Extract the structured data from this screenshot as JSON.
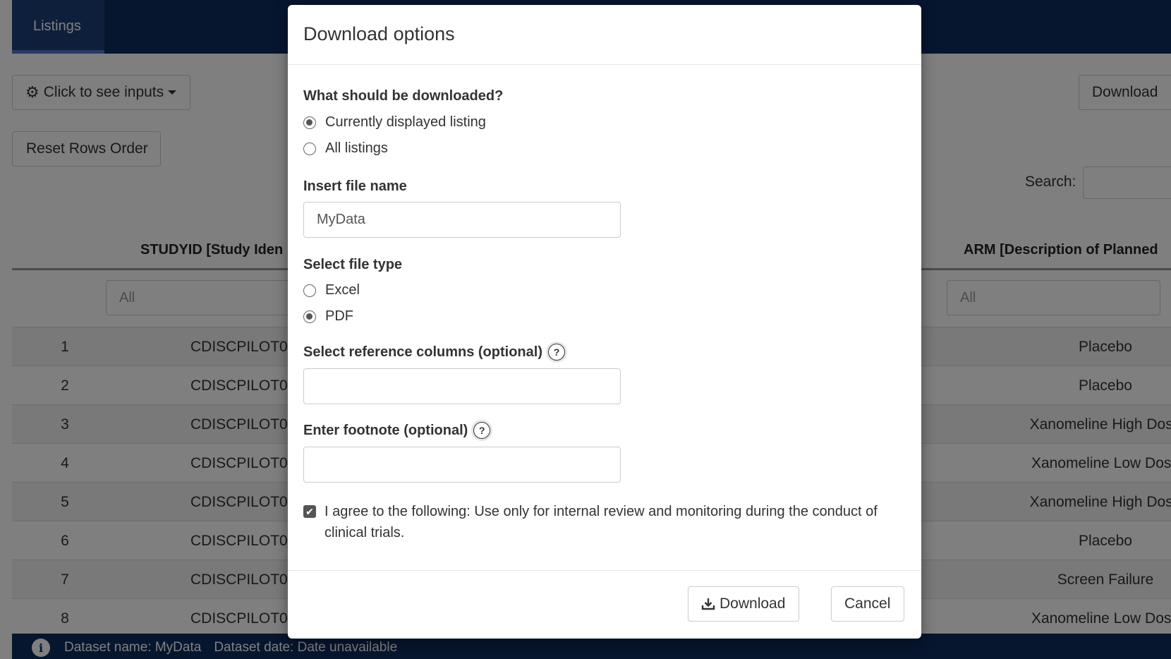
{
  "nav": {
    "tab_label": "Listings"
  },
  "toolbar": {
    "inputs_label": "Click to see inputs",
    "reset_label": "Reset Rows Order",
    "download_label": "Download",
    "search_label": "Search:"
  },
  "table": {
    "headers": {
      "studyid": "STUDYID [Study Iden",
      "arm": "ARM [Description of Planned"
    },
    "filter_placeholder": "All",
    "rows": [
      {
        "num": "1",
        "studyid": "CDISCPILOT0",
        "arm": "Placebo"
      },
      {
        "num": "2",
        "studyid": "CDISCPILOT0",
        "arm": "Placebo"
      },
      {
        "num": "3",
        "studyid": "CDISCPILOT0",
        "arm": "Xanomeline High Dose"
      },
      {
        "num": "4",
        "studyid": "CDISCPILOT0",
        "arm": "Xanomeline Low Dose"
      },
      {
        "num": "5",
        "studyid": "CDISCPILOT0",
        "arm": "Xanomeline High Dose"
      },
      {
        "num": "6",
        "studyid": "CDISCPILOT0",
        "arm": "Placebo"
      },
      {
        "num": "7",
        "studyid": "CDISCPILOT0",
        "arm": "Screen Failure"
      },
      {
        "num": "8",
        "studyid": "CDISCPILOT0",
        "arm": "Xanomeline Low Dose"
      }
    ]
  },
  "footer": {
    "dataset_name": "Dataset name: MyData",
    "dataset_date": "Dataset date: Date unavailable"
  },
  "modal": {
    "title": "Download options",
    "what_label": "What should be downloaded?",
    "what_options": [
      "Currently displayed listing",
      "All listings"
    ],
    "what_selected": "Currently displayed listing",
    "filename_label": "Insert file name",
    "filename_value": "MyData",
    "filetype_label": "Select file type",
    "filetype_options": [
      "Excel",
      "PDF"
    ],
    "filetype_selected": "PDF",
    "refcols_label": "Select reference columns (optional)",
    "footnote_label": "Enter footnote (optional)",
    "help_glyph": "?",
    "agree_text": "I agree to the following: Use only for internal review and monitoring during the conduct of clinical trials.",
    "agree_checked": true,
    "download_label": "Download",
    "cancel_label": "Cancel"
  },
  "icons": {
    "gear": "gear-icon",
    "caret": "caret-down-icon",
    "info": "info-icon",
    "help": "question-circle-icon",
    "download": "download-icon",
    "check": "check-icon"
  }
}
